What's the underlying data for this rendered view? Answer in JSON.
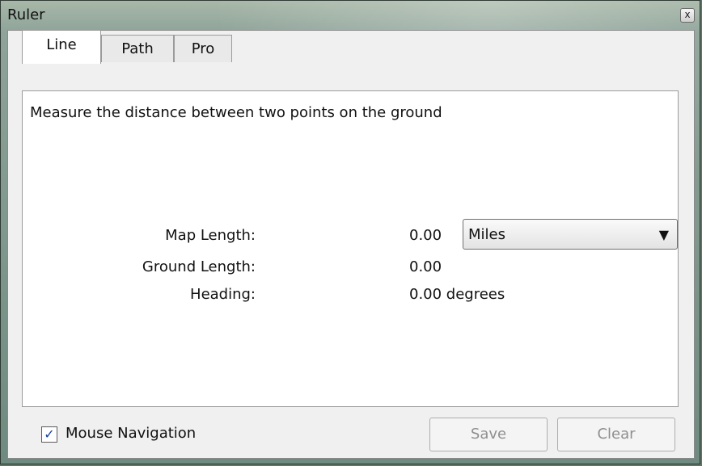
{
  "window": {
    "title": "Ruler",
    "close_glyph": "x"
  },
  "tabs": [
    {
      "label": "Line",
      "active": true
    },
    {
      "label": "Path",
      "active": false
    },
    {
      "label": "Pro",
      "active": false
    }
  ],
  "line_tab": {
    "description": "Measure the distance between two points on the ground",
    "map_length": {
      "label": "Map Length:",
      "value": "0.00"
    },
    "ground_length": {
      "label": "Ground Length:",
      "value": "0.00"
    },
    "heading": {
      "label": "Heading:",
      "value": "0.00 degrees"
    },
    "units_select": {
      "selected": "Miles",
      "arrow_glyph": "▼"
    }
  },
  "footer": {
    "mouse_navigation": {
      "label": "Mouse Navigation",
      "checked": true,
      "check_glyph": "✓"
    },
    "save_label": "Save",
    "clear_label": "Clear"
  }
}
